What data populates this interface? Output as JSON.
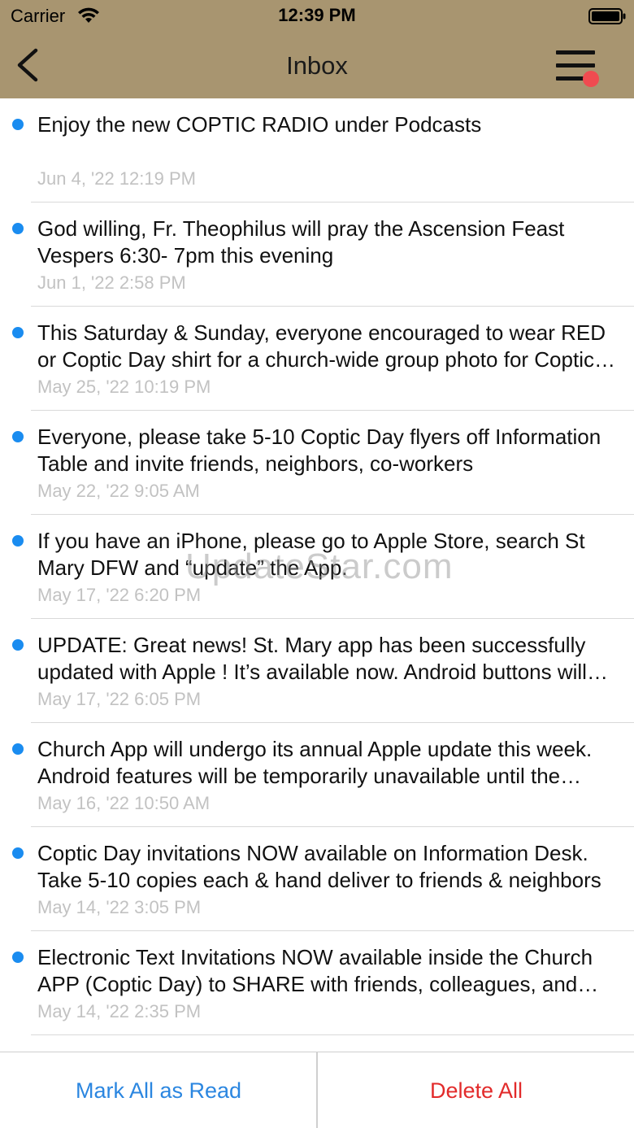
{
  "status_bar": {
    "carrier": "Carrier",
    "time": "12:39 PM"
  },
  "nav": {
    "title": "Inbox",
    "back_icon": "chevron-left-icon",
    "menu_icon": "hamburger-menu-icon",
    "menu_badge_color": "#f04b50"
  },
  "colors": {
    "header_bg": "#a89570",
    "unread_dot": "#1a8cf0",
    "mark_read": "#2b86e0",
    "delete": "#e22b2b"
  },
  "messages": [
    {
      "text": "Enjoy the new COPTIC RADIO under Podcasts",
      "date": "Jun 4, '22 12:19 PM"
    },
    {
      "text": "God willing, Fr. Theophilus will pray the Ascension Feast Vespers 6:30- 7pm this evening",
      "date": "Jun 1, '22 2:58 PM"
    },
    {
      "text": "This Saturday & Sunday, everyone encouraged to wear RED or Coptic Day shirt for a church-wide group photo for Coptic Day",
      "date": "May 25, '22 10:19 PM"
    },
    {
      "text": "Everyone, please take 5-10 Coptic Day flyers off Information Table and invite friends, neighbors, co-workers",
      "date": "May 22, '22 9:05 AM"
    },
    {
      "text": "If you have an iPhone, please go to Apple Store, search St Mary DFW and “update” the App.",
      "date": "May 17, '22 6:20 PM"
    },
    {
      "text": "UPDATE: Great news! St. Mary app has been successfully updated with Apple ! It’s available now.  Android buttons will follow",
      "date": "May 17, '22 6:05 PM"
    },
    {
      "text": "Church App will undergo its annual Apple update this week. Android features will be temporarily unavailable until the update",
      "date": "May 16, '22 10:50 AM"
    },
    {
      "text": "Coptic Day invitations NOW available on Information Desk. Take 5-10 copies each & hand deliver to friends & neighbors",
      "date": "May 14, '22 3:05 PM"
    },
    {
      "text": "Electronic Text Invitations NOW available inside the Church APP (Coptic Day) to SHARE with friends, colleagues, and neighbors",
      "date": "May 14, '22 2:35 PM"
    }
  ],
  "watermark": "UpdateStar.com",
  "toolbar": {
    "mark_all_read": "Mark All as Read",
    "delete_all": "Delete All"
  }
}
